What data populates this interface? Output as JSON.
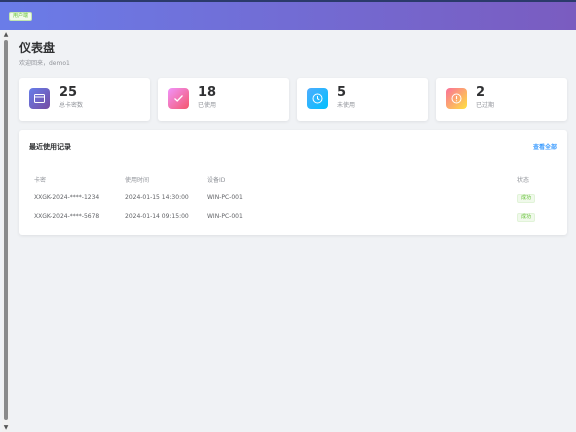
{
  "header": {
    "role_badge": "用户端"
  },
  "page": {
    "title": "仪表盘",
    "welcome": "欢迎回来，demo1"
  },
  "stats": [
    {
      "value": "25",
      "label": "总卡密数",
      "icon": "card-icon",
      "color_from": "#667eea",
      "color_to": "#764ba2"
    },
    {
      "value": "18",
      "label": "已使用",
      "icon": "check-icon",
      "color_from": "#f093fb",
      "color_to": "#f5576c"
    },
    {
      "value": "5",
      "label": "未使用",
      "icon": "clock-icon",
      "color_from": "#4facfe",
      "color_to": "#00c0fe"
    },
    {
      "value": "2",
      "label": "已过期",
      "icon": "warning-icon",
      "color_from": "#fa709a",
      "color_to": "#fee140"
    }
  ],
  "records": {
    "title": "最近使用记录",
    "view_all": "查看全部",
    "columns": [
      "卡密",
      "使用时间",
      "设备ID",
      "状态"
    ],
    "rows": [
      {
        "card": "XXGK-2024-****-1234",
        "time": "2024-01-15 14:30:00",
        "device": "WIN-PC-001",
        "status": "成功"
      },
      {
        "card": "XXGK-2024-****-5678",
        "time": "2024-01-14 09:15:00",
        "device": "WIN-PC-001",
        "status": "成功"
      }
    ]
  },
  "colors": {
    "header_from": "#6a7ce8",
    "header_to": "#7a5cc0",
    "link": "#409eff",
    "success": "#67c23a"
  }
}
